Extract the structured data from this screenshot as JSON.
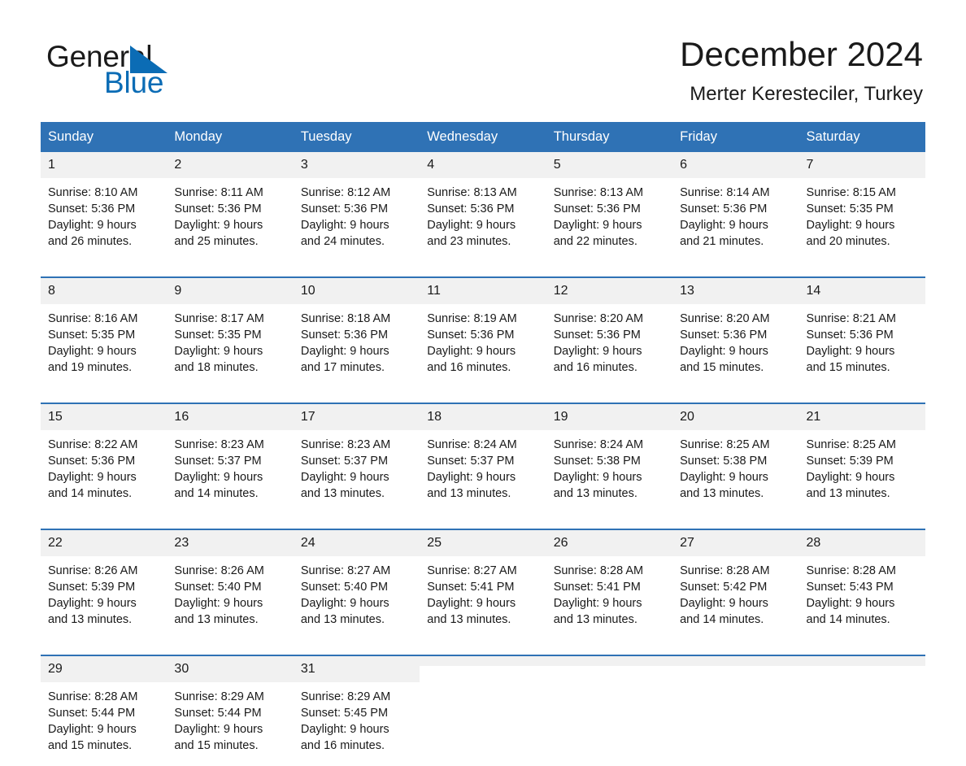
{
  "brand": {
    "name_part1": "General",
    "name_part2": "Blue",
    "logo_icon": "triangle-logo"
  },
  "header": {
    "title": "December 2024",
    "subtitle": "Merter Keresteciler, Turkey"
  },
  "colors": {
    "header_blue": "#2f72b5",
    "brand_blue": "#0b6cb5",
    "daynum_band": "#f1f1f1",
    "text": "#1a1a1a"
  },
  "weekday_headers": [
    "Sunday",
    "Monday",
    "Tuesday",
    "Wednesday",
    "Thursday",
    "Friday",
    "Saturday"
  ],
  "weeks": [
    [
      {
        "day": "1",
        "sunrise": "Sunrise: 8:10 AM",
        "sunset": "Sunset: 5:36 PM",
        "daylight_line1": "Daylight: 9 hours",
        "daylight_line2": "and 26 minutes."
      },
      {
        "day": "2",
        "sunrise": "Sunrise: 8:11 AM",
        "sunset": "Sunset: 5:36 PM",
        "daylight_line1": "Daylight: 9 hours",
        "daylight_line2": "and 25 minutes."
      },
      {
        "day": "3",
        "sunrise": "Sunrise: 8:12 AM",
        "sunset": "Sunset: 5:36 PM",
        "daylight_line1": "Daylight: 9 hours",
        "daylight_line2": "and 24 minutes."
      },
      {
        "day": "4",
        "sunrise": "Sunrise: 8:13 AM",
        "sunset": "Sunset: 5:36 PM",
        "daylight_line1": "Daylight: 9 hours",
        "daylight_line2": "and 23 minutes."
      },
      {
        "day": "5",
        "sunrise": "Sunrise: 8:13 AM",
        "sunset": "Sunset: 5:36 PM",
        "daylight_line1": "Daylight: 9 hours",
        "daylight_line2": "and 22 minutes."
      },
      {
        "day": "6",
        "sunrise": "Sunrise: 8:14 AM",
        "sunset": "Sunset: 5:36 PM",
        "daylight_line1": "Daylight: 9 hours",
        "daylight_line2": "and 21 minutes."
      },
      {
        "day": "7",
        "sunrise": "Sunrise: 8:15 AM",
        "sunset": "Sunset: 5:35 PM",
        "daylight_line1": "Daylight: 9 hours",
        "daylight_line2": "and 20 minutes."
      }
    ],
    [
      {
        "day": "8",
        "sunrise": "Sunrise: 8:16 AM",
        "sunset": "Sunset: 5:35 PM",
        "daylight_line1": "Daylight: 9 hours",
        "daylight_line2": "and 19 minutes."
      },
      {
        "day": "9",
        "sunrise": "Sunrise: 8:17 AM",
        "sunset": "Sunset: 5:35 PM",
        "daylight_line1": "Daylight: 9 hours",
        "daylight_line2": "and 18 minutes."
      },
      {
        "day": "10",
        "sunrise": "Sunrise: 8:18 AM",
        "sunset": "Sunset: 5:36 PM",
        "daylight_line1": "Daylight: 9 hours",
        "daylight_line2": "and 17 minutes."
      },
      {
        "day": "11",
        "sunrise": "Sunrise: 8:19 AM",
        "sunset": "Sunset: 5:36 PM",
        "daylight_line1": "Daylight: 9 hours",
        "daylight_line2": "and 16 minutes."
      },
      {
        "day": "12",
        "sunrise": "Sunrise: 8:20 AM",
        "sunset": "Sunset: 5:36 PM",
        "daylight_line1": "Daylight: 9 hours",
        "daylight_line2": "and 16 minutes."
      },
      {
        "day": "13",
        "sunrise": "Sunrise: 8:20 AM",
        "sunset": "Sunset: 5:36 PM",
        "daylight_line1": "Daylight: 9 hours",
        "daylight_line2": "and 15 minutes."
      },
      {
        "day": "14",
        "sunrise": "Sunrise: 8:21 AM",
        "sunset": "Sunset: 5:36 PM",
        "daylight_line1": "Daylight: 9 hours",
        "daylight_line2": "and 15 minutes."
      }
    ],
    [
      {
        "day": "15",
        "sunrise": "Sunrise: 8:22 AM",
        "sunset": "Sunset: 5:36 PM",
        "daylight_line1": "Daylight: 9 hours",
        "daylight_line2": "and 14 minutes."
      },
      {
        "day": "16",
        "sunrise": "Sunrise: 8:23 AM",
        "sunset": "Sunset: 5:37 PM",
        "daylight_line1": "Daylight: 9 hours",
        "daylight_line2": "and 14 minutes."
      },
      {
        "day": "17",
        "sunrise": "Sunrise: 8:23 AM",
        "sunset": "Sunset: 5:37 PM",
        "daylight_line1": "Daylight: 9 hours",
        "daylight_line2": "and 13 minutes."
      },
      {
        "day": "18",
        "sunrise": "Sunrise: 8:24 AM",
        "sunset": "Sunset: 5:37 PM",
        "daylight_line1": "Daylight: 9 hours",
        "daylight_line2": "and 13 minutes."
      },
      {
        "day": "19",
        "sunrise": "Sunrise: 8:24 AM",
        "sunset": "Sunset: 5:38 PM",
        "daylight_line1": "Daylight: 9 hours",
        "daylight_line2": "and 13 minutes."
      },
      {
        "day": "20",
        "sunrise": "Sunrise: 8:25 AM",
        "sunset": "Sunset: 5:38 PM",
        "daylight_line1": "Daylight: 9 hours",
        "daylight_line2": "and 13 minutes."
      },
      {
        "day": "21",
        "sunrise": "Sunrise: 8:25 AM",
        "sunset": "Sunset: 5:39 PM",
        "daylight_line1": "Daylight: 9 hours",
        "daylight_line2": "and 13 minutes."
      }
    ],
    [
      {
        "day": "22",
        "sunrise": "Sunrise: 8:26 AM",
        "sunset": "Sunset: 5:39 PM",
        "daylight_line1": "Daylight: 9 hours",
        "daylight_line2": "and 13 minutes."
      },
      {
        "day": "23",
        "sunrise": "Sunrise: 8:26 AM",
        "sunset": "Sunset: 5:40 PM",
        "daylight_line1": "Daylight: 9 hours",
        "daylight_line2": "and 13 minutes."
      },
      {
        "day": "24",
        "sunrise": "Sunrise: 8:27 AM",
        "sunset": "Sunset: 5:40 PM",
        "daylight_line1": "Daylight: 9 hours",
        "daylight_line2": "and 13 minutes."
      },
      {
        "day": "25",
        "sunrise": "Sunrise: 8:27 AM",
        "sunset": "Sunset: 5:41 PM",
        "daylight_line1": "Daylight: 9 hours",
        "daylight_line2": "and 13 minutes."
      },
      {
        "day": "26",
        "sunrise": "Sunrise: 8:28 AM",
        "sunset": "Sunset: 5:41 PM",
        "daylight_line1": "Daylight: 9 hours",
        "daylight_line2": "and 13 minutes."
      },
      {
        "day": "27",
        "sunrise": "Sunrise: 8:28 AM",
        "sunset": "Sunset: 5:42 PM",
        "daylight_line1": "Daylight: 9 hours",
        "daylight_line2": "and 14 minutes."
      },
      {
        "day": "28",
        "sunrise": "Sunrise: 8:28 AM",
        "sunset": "Sunset: 5:43 PM",
        "daylight_line1": "Daylight: 9 hours",
        "daylight_line2": "and 14 minutes."
      }
    ],
    [
      {
        "day": "29",
        "sunrise": "Sunrise: 8:28 AM",
        "sunset": "Sunset: 5:44 PM",
        "daylight_line1": "Daylight: 9 hours",
        "daylight_line2": "and 15 minutes."
      },
      {
        "day": "30",
        "sunrise": "Sunrise: 8:29 AM",
        "sunset": "Sunset: 5:44 PM",
        "daylight_line1": "Daylight: 9 hours",
        "daylight_line2": "and 15 minutes."
      },
      {
        "day": "31",
        "sunrise": "Sunrise: 8:29 AM",
        "sunset": "Sunset: 5:45 PM",
        "daylight_line1": "Daylight: 9 hours",
        "daylight_line2": "and 16 minutes."
      },
      {
        "day": "",
        "sunrise": "",
        "sunset": "",
        "daylight_line1": "",
        "daylight_line2": ""
      },
      {
        "day": "",
        "sunrise": "",
        "sunset": "",
        "daylight_line1": "",
        "daylight_line2": ""
      },
      {
        "day": "",
        "sunrise": "",
        "sunset": "",
        "daylight_line1": "",
        "daylight_line2": ""
      },
      {
        "day": "",
        "sunrise": "",
        "sunset": "",
        "daylight_line1": "",
        "daylight_line2": ""
      }
    ]
  ]
}
